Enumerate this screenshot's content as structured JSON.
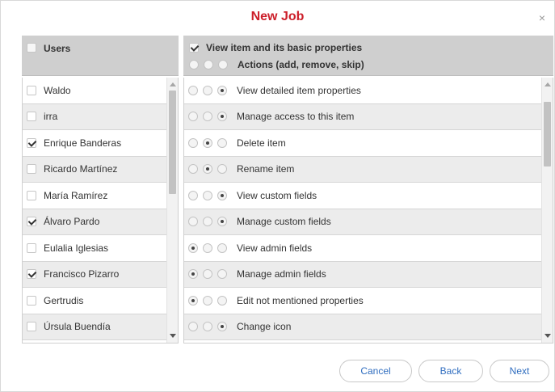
{
  "dialog": {
    "title": "New Job",
    "close_label": "×"
  },
  "users": {
    "header": "Users",
    "header_checked": false,
    "items": [
      {
        "label": "Waldo",
        "checked": false
      },
      {
        "label": "irra",
        "checked": false
      },
      {
        "label": "Enrique Banderas",
        "checked": true
      },
      {
        "label": "Ricardo Martínez",
        "checked": false
      },
      {
        "label": "María Ramírez",
        "checked": false
      },
      {
        "label": "Álvaro Pardo",
        "checked": true
      },
      {
        "label": "Eulalia Iglesias",
        "checked": false
      },
      {
        "label": "Francisco Pizarro",
        "checked": true
      },
      {
        "label": "Gertrudis",
        "checked": false
      },
      {
        "label": "Úrsula Buendía",
        "checked": false
      }
    ]
  },
  "permissions": {
    "header_line1": "View item and its basic properties",
    "header_line1_checked": true,
    "header_line2": "Actions (add, remove, skip)",
    "header_line2_selected": -1,
    "items": [
      {
        "label": "View detailed item properties",
        "selected": 2
      },
      {
        "label": "Manage access to this item",
        "selected": 2
      },
      {
        "label": "Delete item",
        "selected": 1
      },
      {
        "label": "Rename item",
        "selected": 1
      },
      {
        "label": "View custom fields",
        "selected": 2
      },
      {
        "label": "Manage custom fields",
        "selected": 2
      },
      {
        "label": "View admin fields",
        "selected": 0
      },
      {
        "label": "Manage admin fields",
        "selected": 0
      },
      {
        "label": "Edit not mentioned properties",
        "selected": 0
      },
      {
        "label": "Change icon",
        "selected": 2
      }
    ]
  },
  "buttons": {
    "cancel": "Cancel",
    "back": "Back",
    "next": "Next"
  }
}
